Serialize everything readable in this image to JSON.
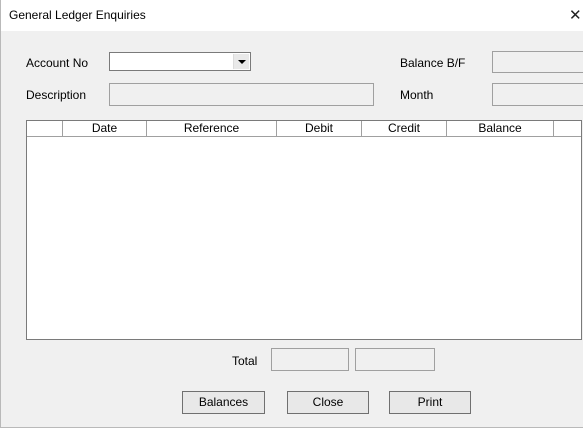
{
  "window": {
    "title": "General Ledger Enquiries"
  },
  "form": {
    "account_no_label": "Account No",
    "account_no_value": "",
    "description_label": "Description",
    "description_value": "",
    "balance_bf_label": "Balance B/F",
    "balance_bf_value": "",
    "month_label": "Month",
    "month_value": ""
  },
  "grid": {
    "columns": [
      "",
      "Date",
      "Reference",
      "Debit",
      "Credit",
      "Balance",
      ""
    ],
    "rows": []
  },
  "footer": {
    "total_label": "Total",
    "total_debit": "",
    "total_credit": ""
  },
  "buttons": {
    "balances": "Balances",
    "close": "Close",
    "print": "Print"
  }
}
